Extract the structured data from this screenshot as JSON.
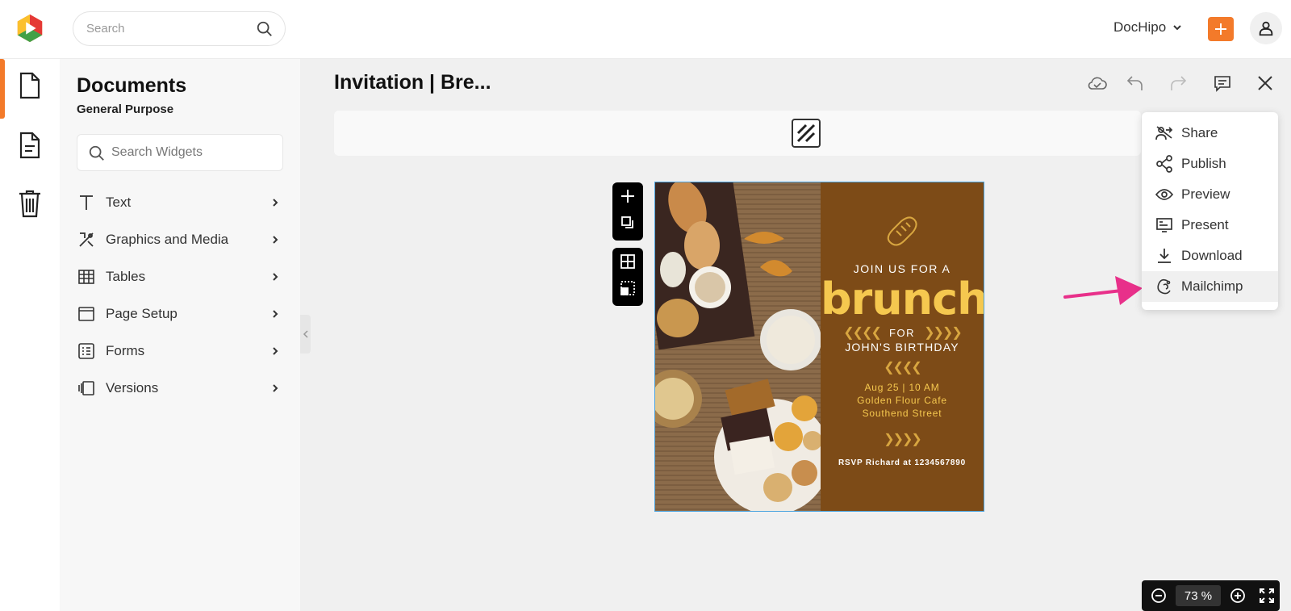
{
  "topbar": {
    "search_placeholder": "Search",
    "account_name": "DocHipo"
  },
  "panel": {
    "title": "Documents",
    "subtitle": "General Purpose",
    "search_placeholder": "Search Widgets",
    "items": [
      {
        "label": "Text",
        "icon": "text-icon"
      },
      {
        "label": "Graphics and Media",
        "icon": "graphics-icon"
      },
      {
        "label": "Tables",
        "icon": "table-icon"
      },
      {
        "label": "Page Setup",
        "icon": "page-setup-icon"
      },
      {
        "label": "Forms",
        "icon": "forms-icon"
      },
      {
        "label": "Versions",
        "icon": "versions-icon"
      }
    ]
  },
  "editor": {
    "doc_title": "Invitation | Bre..."
  },
  "invitation": {
    "line1": "JOIN US FOR A",
    "headline": "brunch",
    "for_text": "FOR",
    "name": "JOHN'S BIRTHDAY",
    "date": "Aug 25 | 10 AM",
    "place": "Golden Flour Cafe",
    "street": "Southend Street",
    "rsvp": "RSVP Richard at 1234567890",
    "arrows_left": "❮❮❮❮",
    "arrows_right": "❯❯❯❯"
  },
  "menu": {
    "items": [
      {
        "label": "Share",
        "icon": "share-icon"
      },
      {
        "label": "Publish",
        "icon": "publish-icon"
      },
      {
        "label": "Preview",
        "icon": "eye-icon"
      },
      {
        "label": "Present",
        "icon": "present-icon"
      },
      {
        "label": "Download",
        "icon": "download-icon"
      },
      {
        "label": "Mailchimp",
        "icon": "mailchimp-icon"
      }
    ],
    "highlighted": "Mailchimp"
  },
  "zoom": {
    "value": "73 %"
  },
  "colors": {
    "accent": "#f37a2a",
    "invitation_brown": "#7d4b17",
    "headline_yellow": "#f5c84f",
    "pointer_pink": "#e8308a"
  }
}
